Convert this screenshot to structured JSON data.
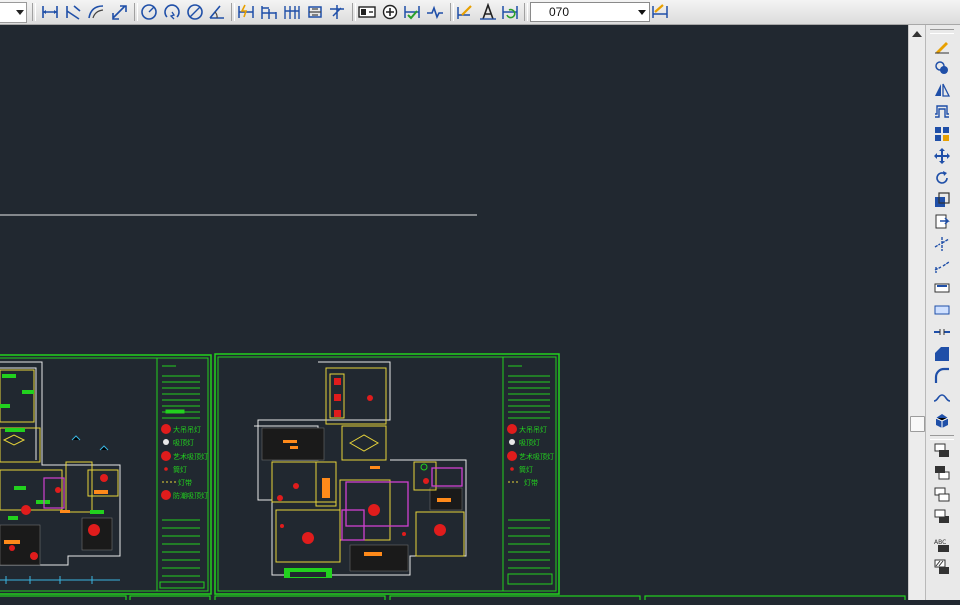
{
  "toolbar": {
    "groups": [
      {
        "name": "dimension-group-1",
        "icons": [
          "linear-dimension-icon",
          "aligned-dimension-icon",
          "arc-length-dimension-icon",
          "ordinate-dimension-icon"
        ]
      },
      {
        "name": "dimension-group-2",
        "icons": [
          "radius-dimension-icon",
          "jogged-dimension-icon",
          "diameter-dimension-icon",
          "angular-dimension-icon"
        ]
      },
      {
        "name": "dimension-group-3",
        "icons": [
          "quick-dimension-icon",
          "baseline-dimension-icon",
          "continue-dimension-icon",
          "dimension-space-icon",
          "dimension-break-icon"
        ]
      },
      {
        "name": "dimension-group-4",
        "icons": [
          "tolerance-icon",
          "center-mark-icon",
          "inspection-icon",
          "jogged-linear-icon"
        ]
      },
      {
        "name": "dimension-group-5",
        "icons": [
          "dimension-edit-icon",
          "dimension-text-edit-icon",
          "dimension-update-icon"
        ]
      }
    ],
    "dim_style_value": "070",
    "dim_style_icon": "dimension-style-icon"
  },
  "modify_toolbar": {
    "icons": [
      "erase-icon",
      "copy-icon",
      "mirror-icon",
      "offset-icon",
      "array-icon",
      "move-icon",
      "rotate-icon",
      "scale-icon",
      "stretch-icon",
      "trim-icon",
      "extend-icon",
      "break-at-point-icon",
      "break-icon",
      "join-icon",
      "chamfer-icon",
      "fillet-icon",
      "blend-curves-icon",
      "explode-icon"
    ],
    "draw_order_icons": [
      "bring-to-front-icon",
      "send-to-back-icon",
      "bring-above-icon",
      "send-under-icon",
      "text-to-front-icon",
      "hatch-to-back-icon"
    ]
  },
  "drawing": {
    "sheets": [
      {
        "name": "left-floor-plan-sheet",
        "legend": [
          "大吊吊灯",
          "吸顶灯",
          "艺术吸顶灯",
          "筒灯",
          "灯带",
          "防潮吸顶灯"
        ]
      },
      {
        "name": "right-floor-plan-sheet",
        "legend": [
          "大吊吊灯",
          "吸顶灯",
          "艺术吸顶灯",
          "筒灯",
          "灯带"
        ]
      }
    ],
    "colors": {
      "background": "#212830",
      "frame": "#22d11e",
      "walls": "#e8e8e8",
      "rooms": "#e6d33a",
      "fixtures": "#e01c1c",
      "accent": "#d040d0",
      "ceiling": "#ff8a1a",
      "dims": "#3ab4e0"
    }
  }
}
